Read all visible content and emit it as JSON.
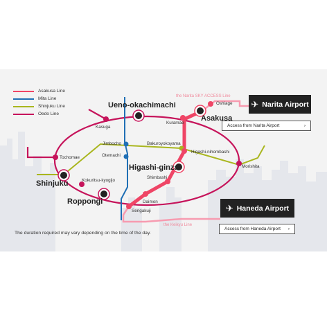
{
  "legend": [
    {
      "label": "Asakusa Line",
      "color": "#ef4566"
    },
    {
      "label": "Mita Line",
      "color": "#1f6fb5"
    },
    {
      "label": "Shinjuku Line",
      "color": "#a9b61e"
    },
    {
      "label": "Oedo Line",
      "color": "#c6145b"
    }
  ],
  "stations": {
    "ueno_okachimachi": "Ueno-okachimachi",
    "asakusa": "Asakusa",
    "kuramae": "Kuramae",
    "oshiage": "Oshiage",
    "kasuga": "Kasuga",
    "jimbocho": "Jimbocho",
    "bakuroyokoyama": "Bakuroyokoyama",
    "otemachi": "Otemachi",
    "higashi_nihombashi": "Higashi-nihombashi",
    "tochomae": "Tochomae",
    "higashi_ginza": "Higashi-ginza",
    "morishita": "Morishita",
    "shinjuku": "Shinjuku",
    "shimbashi": "Shimbashi",
    "kokuritsu_kyogijo": "Kokuritsu-kyogijo",
    "roppongi": "Roppongi",
    "daimon": "Daimon",
    "sengakuji": "Sengakuji"
  },
  "line_notes": {
    "narita_access": "the Narita SKY ACCESS Line",
    "keikyu": "the Keikyu Line"
  },
  "airports": {
    "narita": {
      "label": "Narita Airport",
      "icon": "airplane-icon",
      "access": "Access from Narita Airport"
    },
    "haneda": {
      "label": "Haneda Airport",
      "icon": "airplane-icon",
      "access": "Access from Haneda Airport"
    }
  },
  "note": "The duration required may vary depending on the time of the day."
}
